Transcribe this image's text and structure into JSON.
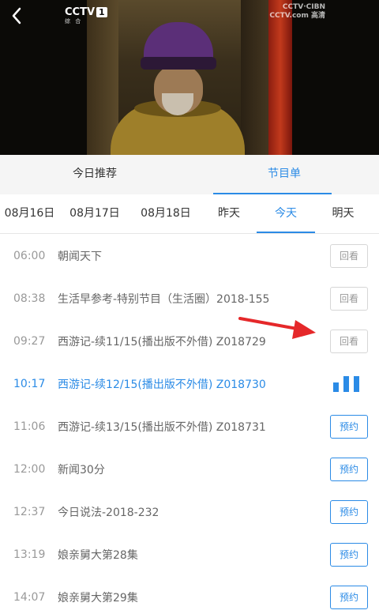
{
  "video": {
    "channel_logo": "CCTV",
    "channel_number": "1",
    "channel_sub": "综 合",
    "watermark_line1": "CCTV·CIBN",
    "watermark_line2": "CCTV.com 高清"
  },
  "tabs": [
    {
      "label": "今日推荐",
      "active": false
    },
    {
      "label": "节目单",
      "active": true
    }
  ],
  "dates": [
    {
      "label": "08月16日",
      "active": false
    },
    {
      "label": "08月17日",
      "active": false
    },
    {
      "label": "08月18日",
      "active": false
    },
    {
      "label": "昨天",
      "active": false
    },
    {
      "label": "今天",
      "active": true
    },
    {
      "label": "明天",
      "active": false
    }
  ],
  "programs": [
    {
      "time": "06:00",
      "title": "朝闻天下",
      "action": "回看"
    },
    {
      "time": "08:38",
      "title": "生活早参考-特别节目（生活圈）2018-155",
      "action": "回看"
    },
    {
      "time": "09:27",
      "title": "西游记-续11/15(播出版不外借) Z018729",
      "action": "回看"
    },
    {
      "time": "10:17",
      "title": "西游记-续12/15(播出版不外借) Z018730",
      "action": ""
    },
    {
      "time": "11:06",
      "title": "西游记-续13/15(播出版不外借) Z018731",
      "action": "预约"
    },
    {
      "time": "12:00",
      "title": "新闻30分",
      "action": "预约"
    },
    {
      "time": "12:37",
      "title": "今日说法-2018-232",
      "action": "预约"
    },
    {
      "time": "13:19",
      "title": "娘亲舅大第28集",
      "action": "预约"
    },
    {
      "time": "14:07",
      "title": "娘亲舅大第29集",
      "action": "预约"
    }
  ],
  "colors": {
    "accent": "#2b8be6",
    "annotation_arrow": "#e5282a"
  }
}
